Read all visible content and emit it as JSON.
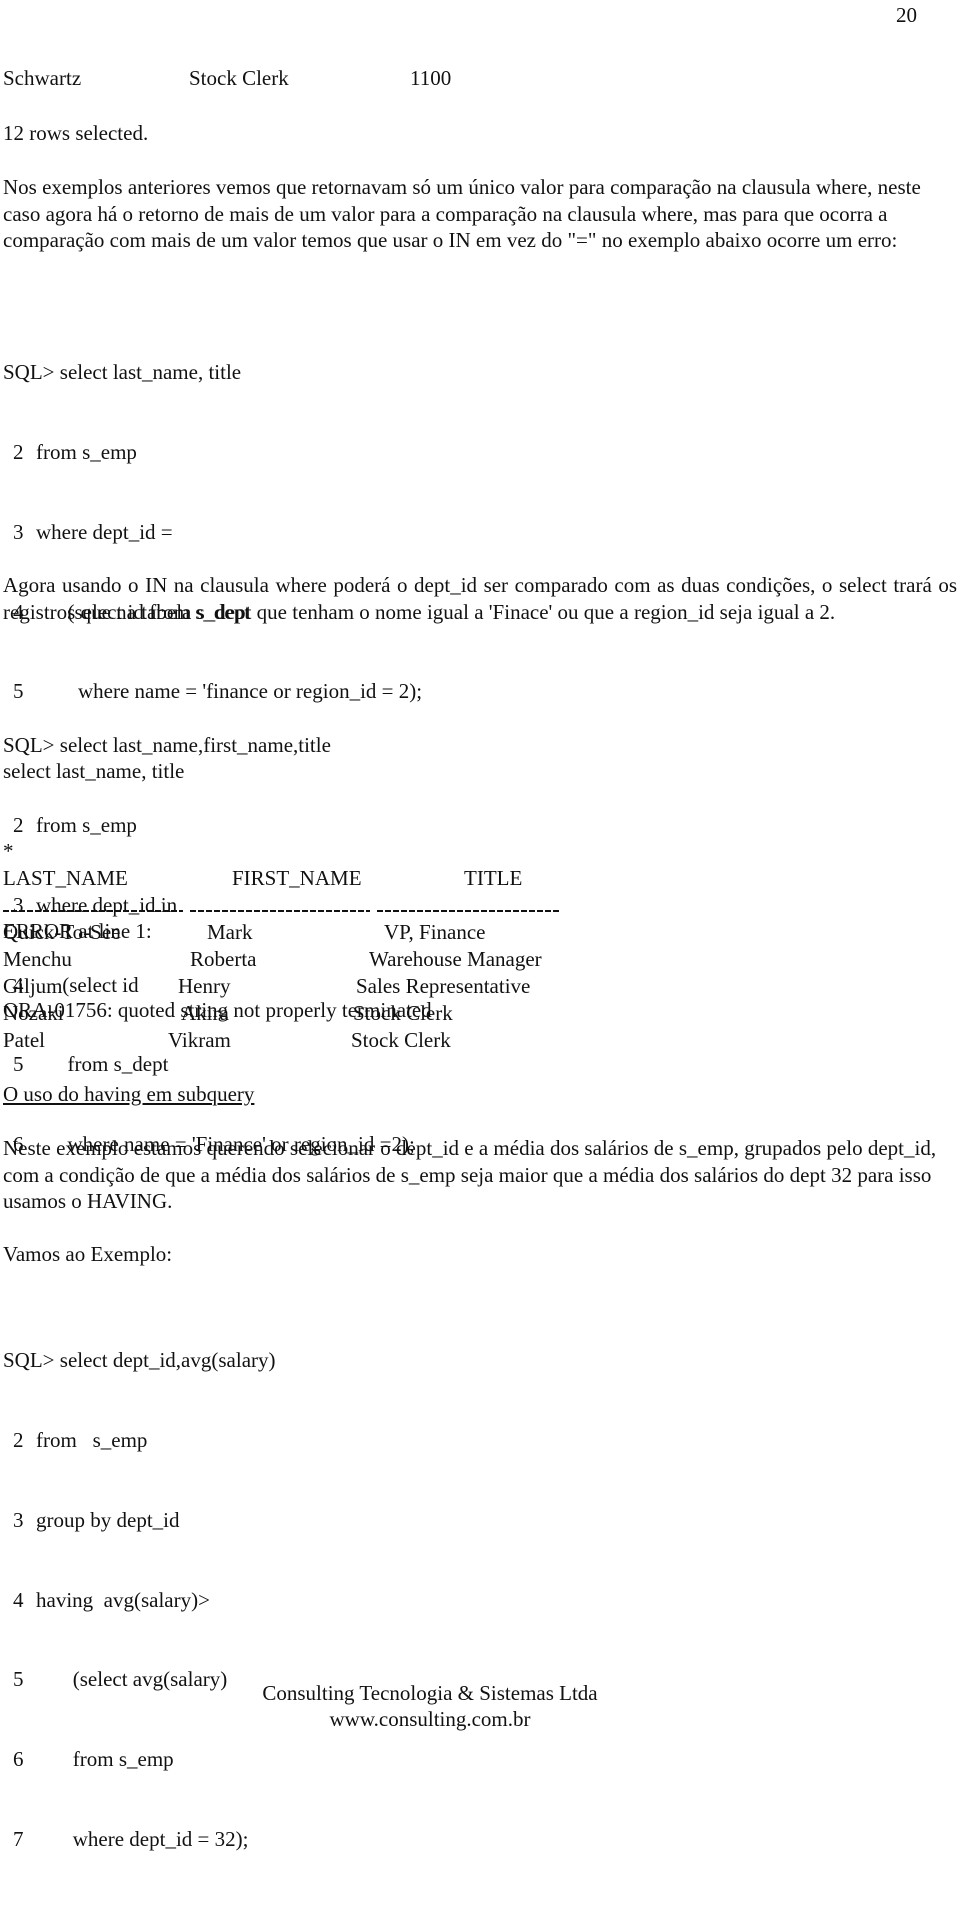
{
  "page_number": "20",
  "carryover_row": {
    "last_name": "Schwartz",
    "title": "Stock Clerk",
    "salary": "1100"
  },
  "rows_selected": "12 rows selected.",
  "intro_paragraph": "Nos exemplos anteriores vemos que retornavam só um único valor para comparação na clausula where, neste caso agora há o retorno de mais de um valor para a comparação na clausula where, mas para que ocorra a comparação com mais de um valor temos que usar o IN em vez do \"=\" no exemplo abaixo ocorre um erro:",
  "error_example": {
    "prompt_line": "SQL> select last_name, title",
    "lines": [
      {
        "n": "2",
        "indent": "",
        "text": "from s_emp"
      },
      {
        "n": "3",
        "indent": "",
        "text": "where dept_id ="
      },
      {
        "n": "4",
        "indent": "      ",
        "text": "(select id from s_dept"
      },
      {
        "n": "5",
        "indent": "        ",
        "text": "where name = 'finance or region_id = 2);"
      }
    ],
    "echo_line": "select last_name, title",
    "marker": "*",
    "error_line": "ERROR at line 1:",
    "ora_message": "ORA-01756: quoted string not properly terminated"
  },
  "in_paragraph": "Agora usando o IN na clausula where poderá o dept_id ser comparado com as duas condições, o select trará os registros que na tabela s_dept que tenham o nome igual a 'Finace' ou que a region_id seja igual a 2.",
  "in_example": {
    "prompt_line": "SQL> select last_name,first_name,title",
    "lines": [
      {
        "n": "2",
        "indent": "",
        "text": "from s_emp"
      },
      {
        "n": "3",
        "indent": "",
        "text": "where dept_id in"
      },
      {
        "n": "4",
        "indent": "     ",
        "text": "(select id"
      },
      {
        "n": "5",
        "indent": "      ",
        "text": "from s_dept"
      },
      {
        "n": "6",
        "indent": "      ",
        "text": "where name = 'Finance' or region_id =2);"
      }
    ]
  },
  "result_table": {
    "headers": [
      "LAST_NAME",
      "FIRST_NAME",
      "TITLE"
    ],
    "rows": [
      [
        "Quick-To-See",
        "Mark",
        "VP, Finance"
      ],
      [
        "Menchu",
        "Roberta",
        "Warehouse Manager"
      ],
      [
        "Giljum",
        "Henry",
        "Sales Representative"
      ],
      [
        "Nozaki",
        "Akira",
        "Stock Clerk"
      ],
      [
        "Patel",
        "Vikram",
        "Stock Clerk"
      ]
    ]
  },
  "having_heading": "O uso do having em subquery",
  "having_paragraph": "Neste exemplo estamos querendo selecionar o dept_id e a média dos salários de s_emp, grupados pelo dept_id, com a condição de que a média dos salários de s_emp seja maior que a média dos salários do dept 32 para isso usamos o HAVING.",
  "example_intro": "Vamos ao Exemplo:",
  "having_example": {
    "prompt_line": "SQL> select dept_id,avg(salary)",
    "lines": [
      {
        "n": "2",
        "indent": "",
        "text": "from   s_emp"
      },
      {
        "n": "3",
        "indent": "",
        "text": "group by dept_id"
      },
      {
        "n": "4",
        "indent": "",
        "text": "having  avg(salary)>"
      },
      {
        "n": "5",
        "indent": "       ",
        "text": "(select avg(salary)"
      },
      {
        "n": "6",
        "indent": "       ",
        "text": "from s_emp"
      },
      {
        "n": "7",
        "indent": "       ",
        "text": "where dept_id = 32);"
      }
    ]
  },
  "footer": {
    "company": "Consulting Tecnologia & Sistemas Ltda",
    "website": "www.consulting.com.br"
  }
}
